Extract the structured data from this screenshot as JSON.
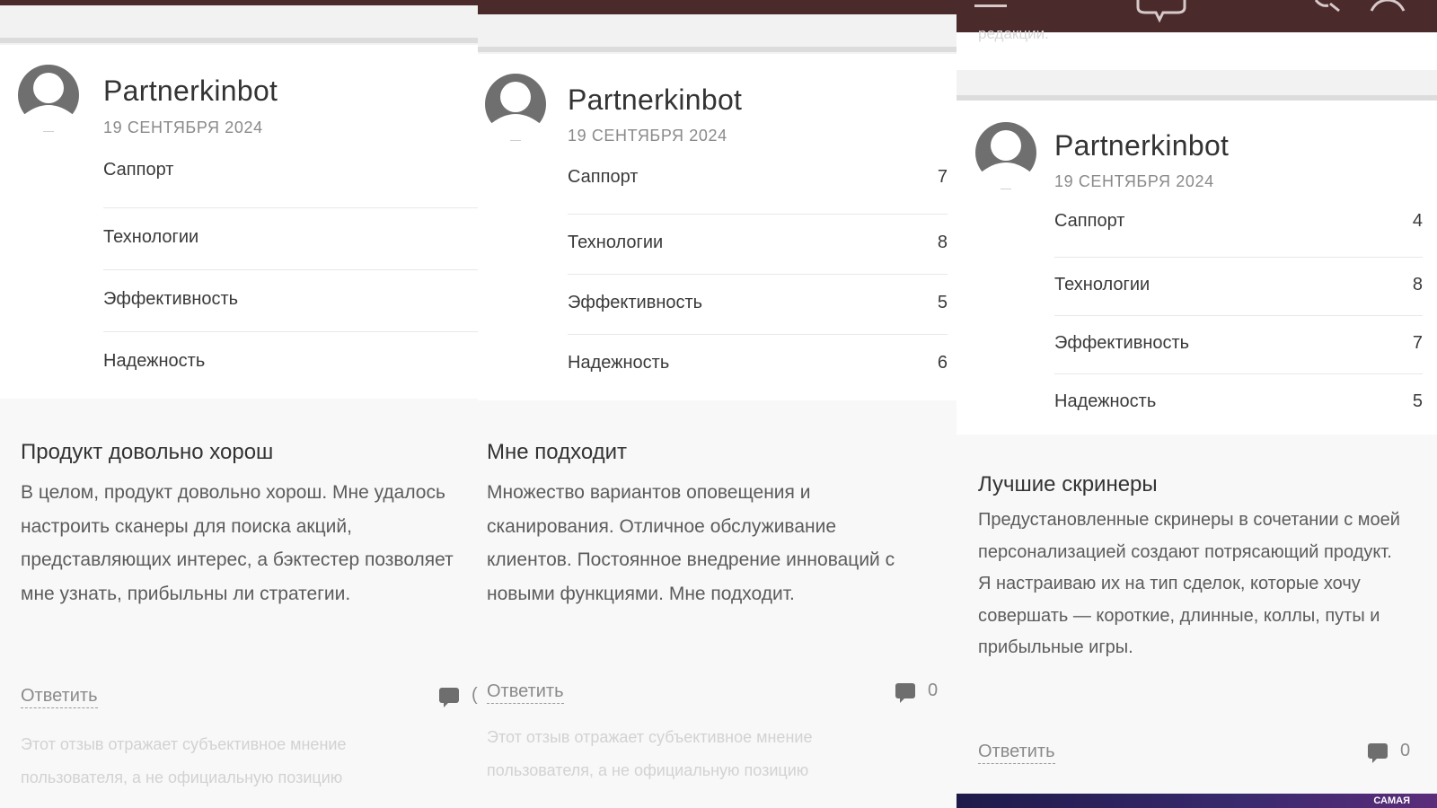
{
  "panels": [
    {
      "user": "Partnerkinbot",
      "date": "19 СЕНТЯБРЯ 2024",
      "ratings": [
        {
          "label": "Саппорт",
          "score": ""
        },
        {
          "label": "Технологии",
          "score": ""
        },
        {
          "label": "Эффективность",
          "score": ""
        },
        {
          "label": "Надежность",
          "score": ""
        }
      ],
      "title": "Продукт довольно хорош",
      "body": "В целом, продукт довольно хорош. Мне удалось настроить сканеры для поиска акций, представляющих интерес, а бэктестер позволяет мне узнать, прибыльны ли стратегии.",
      "reply": "Ответить",
      "comments": "(",
      "disclaimer": "Этот отзыв отражает субъективное мнение пользователя, а не официальную позицию"
    },
    {
      "user": "Partnerkinbot",
      "date": "19 СЕНТЯБРЯ 2024",
      "ratings": [
        {
          "label": "Саппорт",
          "score": "7"
        },
        {
          "label": "Технологии",
          "score": "8"
        },
        {
          "label": "Эффективность",
          "score": "5"
        },
        {
          "label": "Надежность",
          "score": "6"
        }
      ],
      "title": "Мне подходит",
      "body": "Множество вариантов оповещения и сканирования. Отличное обслуживание клиентов. Постоянное внедрение инноваций с новыми функциями. Мне подходит.",
      "reply": "Ответить",
      "comments": "0",
      "disclaimer": "Этот отзыв отражает субъективное мнение пользователя, а не официальную позицию"
    },
    {
      "user": "Partnerkinbot",
      "date": "19 СЕНТЯБРЯ 2024",
      "ratings": [
        {
          "label": "Саппорт",
          "score": "4"
        },
        {
          "label": "Технологии",
          "score": "8"
        },
        {
          "label": "Эффективность",
          "score": "7"
        },
        {
          "label": "Надежность",
          "score": "5"
        }
      ],
      "title": "Лучшие скринеры",
      "body": "Предустановленные скринеры в сочетании с моей персонализацией создают потрясающий продукт. Я настраиваю их на тип сделок, которые хочу совершать — короткие, длинные, коллы, путы и прибыльные игры.",
      "reply": "Ответить",
      "comments": "0",
      "top_fragment": "редакции.",
      "ad_text": "САМАЯ"
    }
  ],
  "colors": {
    "topbar": "#4a2a2b",
    "gap": "#f3f2f2",
    "review_bg": "#f8f8f8"
  },
  "icons": [
    "menu-icon",
    "chat-icon",
    "search-icon",
    "user-icon",
    "avatar-icon",
    "comment-icon"
  ]
}
